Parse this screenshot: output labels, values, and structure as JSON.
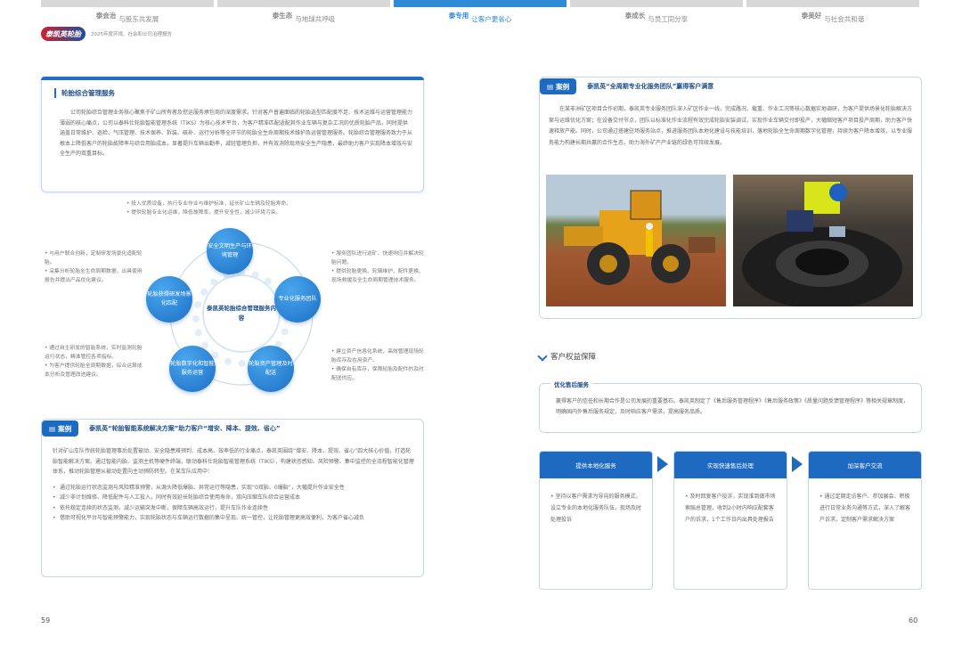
{
  "nav": {
    "tabs": [
      {
        "num": "泰会治",
        "text": "与股东共发展"
      },
      {
        "num": "泰生态",
        "text": "与地球共呼吸"
      },
      {
        "num": "泰专用",
        "text": "让客户更省心"
      },
      {
        "num": "泰成长",
        "text": "与员工同分享"
      },
      {
        "num": "泰美好",
        "text": "与社会共和谐"
      }
    ]
  },
  "logo": {
    "mark": "泰凯英轮胎",
    "sub": "2025年度环境、社会和公司治理报告"
  },
  "mgmt": {
    "title": "轮胎综合管理服务",
    "text": "公司轮胎综合管理业务核心聚焦于矿山所有者及挖运服务承包商的深度需求。针对客户普遍面临的轮胎选型匹配度不足、技术运维与运营管理能力薄弱的核心痛点，公司以泰科仕轮胎智能管理系统（TiKS）为核心技术平台，为客户精准匹配适配其作业车辆与复杂工况的优质轮胎产品，同时提供涵盖日常维护、巡检、气压管理、技术保养、拆装、硫补、运行分析等全环节的轮胎全生命周期技术维护及运营管理服务。轮胎综合管理服务致力于从根本上降低客户的轮胎故障率与综合用胎成本，显著提升车辆出勤率，减轻管理负担，并有效消除现场安全生产隐患，最终助力客户实现降本增效与安全生产的双重目标。"
  },
  "diagram": {
    "center": "泰凯英轮胎综合管理服务内容",
    "nodes": [
      "安全文明生产与环境管理",
      "专业化服务团队",
      "轮胎资产管理及时配送",
      "轮胎数字化和智能服务运营",
      "轮胎获得研发场景化匹配"
    ],
    "top_bullets": [
      "• 投入优质设备，执行专业作业与维护标准，延长矿山车辆及轮胎寿命。",
      "• 提供轮胎专业化运维，降低故障率，提升安全性，减少环境污染。"
    ],
    "left_bullets_1": [
      "• 与用户联合创新，定制研发场景化适配轮胎。",
      "• 采集分析轮胎全生命周期数据，出具使用报告并提出产品优化建议。"
    ],
    "left_bullets_2": [
      "• 通过自主研发的智能系统，实时监测轮胎运行状态，精准管控各项指标。",
      "• 为客户提供轮胎全周期数据，综合运算成本分析及管理改进建议。"
    ],
    "right_bullets_1": [
      "• 服务团队进行巡矿、快速响应并解决轮胎问题。",
      "• 提供轮胎更换、轮辋维护、配件更换、现场救援及全生命周期管理技术服务。"
    ],
    "right_bullets_2": [
      "• 建立资产信息化系统，高效管理现场轮胎库存及在用资产。",
      "• 确保自有库存，保障轮胎及配件的及时配送供应。"
    ]
  },
  "case1": {
    "badge": "案例",
    "title": "泰凯英“轮胎智能系统解决方案”助力客户“增安、降本、提效、省心”",
    "intro": "针对矿山车队传统轮胎管理事后处置被动、安全隐患难预判、成本高、效率低的行业痛点，泰凯英围绕“增安、降本、提效、省心”四大核心价值，打造轮胎智能解决方案。通过智能内胎、监测主机等硬件终端，联动泰科仕轮胎智能管理系统（TiKS），构建状态感知、风险预警、集中监控的全流程智能化管理体系，推动轮胎管理从被动处置向主动预防转型。在某车队应用中：",
    "items": [
      "通过轮胎运行状态监测与风险精准预警，从源头降低爆胎、异常运行等隐患，实现“0双胎、0爆胎”，大幅提升作业安全性",
      "减少非计划维修、降低配件与人工投入，同时有效延长轮胎综合使用寿命，双向压缩车队综合运营成本",
      "依托稳定连续的状态监测，减少运输突发中断，保障车辆高效运行，提升车队作业连续性",
      "借助可视化平台与智能预警能力，实现轮胎状态与车辆运行数据的集中呈现、统一管控，让轮胎管理更高效便利，为客户省心减负"
    ]
  },
  "case2": {
    "badge": "案例",
    "title": "泰凯英“全周期专业化服务团队”赢得客户满意",
    "text": "在某非洲矿区项目合作初期，泰凯英专业服务团队深入矿区作业一线，完成路况、载重、作业工况等核心数据实地调研，为客户提供场景化轮胎解决方案与运维优化方案；在设备交付节点，团队以标准化作业流程有效完成轮胎安装调试，实现作业车辆交付即投产，大幅缩短客户项目投产周期，助力客户快速释放产能。同时，公司通过搭建驻场服务站点，推进服务团队本地化建设与技能培训，落地轮胎全生命周期数字化管理，持续为客户降本增效，以专业服务能力构建长期共赢的合作生态，助力海外矿产产业链的绿色可持续发展。"
  },
  "rights": {
    "title": "客户权益保障",
    "service_title": "优化售后服务",
    "service_text": "赢得客户的信任和长期合作是公司发展的重要基石。泰凯英制定了《售后服务管理程序》《售后服务政策》《质量问题反馈管理程序》等相关规章制度，明确国内外售后服务规定，及时响应客户需求，提高服务品质。",
    "cards": [
      {
        "title": "提供本地化服务",
        "text": "• 坚持以客户需求为导向的服务模式，设立专业的本地化服务队伍，现场及时处理投诉"
      },
      {
        "title": "实现快速售后处理",
        "text": "• 及时回复客户投诉，实现谁到做市场索赔总管理，收到2小时内响应配套客户的诉求，1个工作日内出具处理报告"
      },
      {
        "title": "加深客户交流",
        "text": "• 通过定期走访客户、参加展会、积极进行日常业务沟通等方式，深入了解客户诉求，定制客户需求解决方案"
      }
    ]
  },
  "page_left": "59",
  "page_right": "60",
  "colors": {
    "accent": "#1d6ac0",
    "nav_active": "#2f8bd6",
    "title": "#1f4f8c"
  }
}
